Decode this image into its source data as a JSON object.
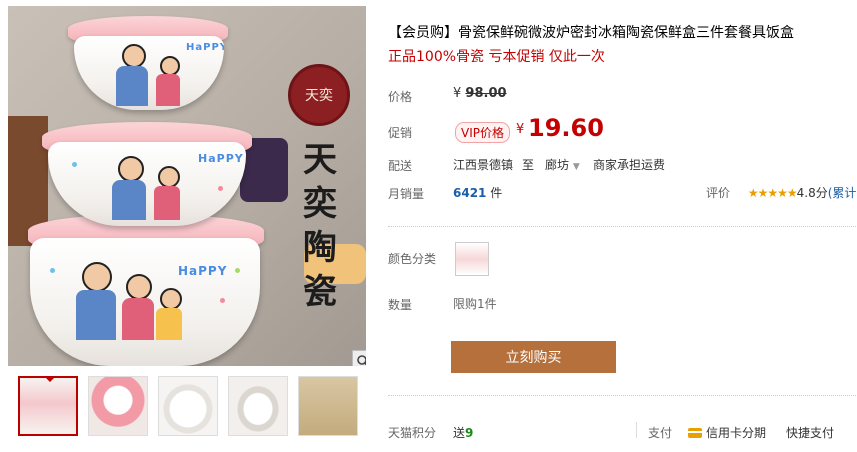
{
  "gallery": {
    "brand_vertical": "天奕陶瓷",
    "brand_seal": "天奕",
    "bowl_text": "HaPPY",
    "thumbnails": [
      "thumb-1",
      "thumb-2",
      "thumb-3",
      "thumb-4",
      "thumb-5"
    ]
  },
  "product": {
    "title": "【会员购】骨瓷保鲜碗微波炉密封冰箱陶瓷保鲜盒三件套餐具饭盒",
    "subtitle": "正品100%骨瓷 亏本促销 仅此一次",
    "price_label": "价格",
    "currency": "¥",
    "original_price": "98.00",
    "promo_label": "促销",
    "vip_tag": "VIP价格",
    "promo_price": "19.60",
    "shipping_label": "配送",
    "ship_from": "江西景德镇",
    "ship_to_word": "至",
    "ship_to": "廊坊",
    "ship_fee": "商家承担运费",
    "sales_label": "月销量",
    "sales_count": "6421",
    "sales_unit": "件",
    "rating_label": "评价",
    "rating_stars": "★★★★★",
    "rating_score": "4.8分",
    "rating_more": "(累计",
    "color_label": "颜色分类",
    "qty_label": "数量",
    "qty_limit": "限购1件",
    "buy_button": "立刻购买",
    "points_label": "天猫积分",
    "points_prefix": "送",
    "points_value": "9",
    "pay_label": "支付",
    "pay_card": "信用卡分期",
    "pay_quick": "快捷支付"
  },
  "colors": {
    "accent_red": "#c40000",
    "buy_button": "#b5703b",
    "link_blue": "#1a5ea8",
    "star": "#e8a000"
  }
}
